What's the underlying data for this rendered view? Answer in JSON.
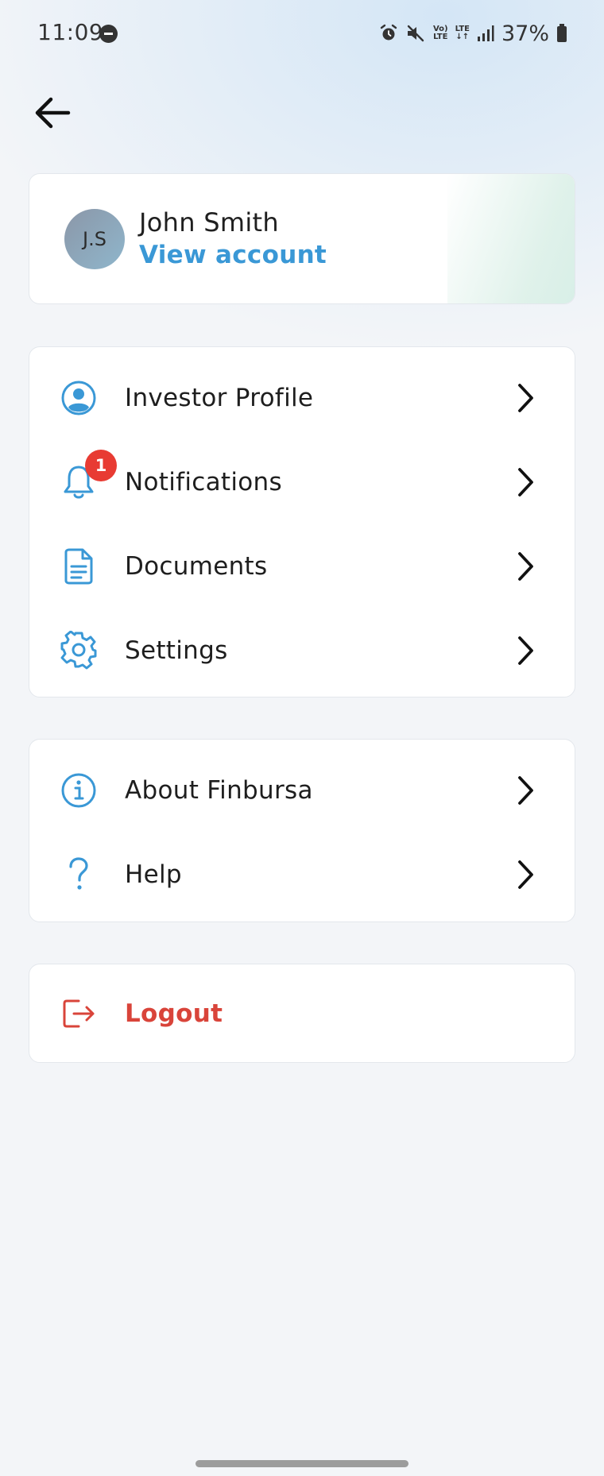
{
  "status_bar": {
    "time": "11:09",
    "lte_top": "Vo)",
    "lte_bottom": "LTE",
    "lte2_top": "LTE",
    "lte2_bottom": "↓↑",
    "battery": "37%"
  },
  "profile": {
    "initials": "J.S",
    "name": "John Smith",
    "link": "View account"
  },
  "menu_group_1": [
    {
      "label": "Investor Profile",
      "icon": "user-circle-icon"
    },
    {
      "label": "Notifications",
      "icon": "bell-icon",
      "badge": "1"
    },
    {
      "label": "Documents",
      "icon": "document-icon"
    },
    {
      "label": "Settings",
      "icon": "gear-icon"
    }
  ],
  "menu_group_2": [
    {
      "label": "About Finbursa",
      "icon": "info-icon"
    },
    {
      "label": "Help",
      "icon": "question-icon"
    }
  ],
  "logout": {
    "label": "Logout",
    "icon": "logout-icon"
  },
  "colors": {
    "accent": "#3a98d6",
    "danger": "#d9443a",
    "badge": "#e83b33"
  }
}
